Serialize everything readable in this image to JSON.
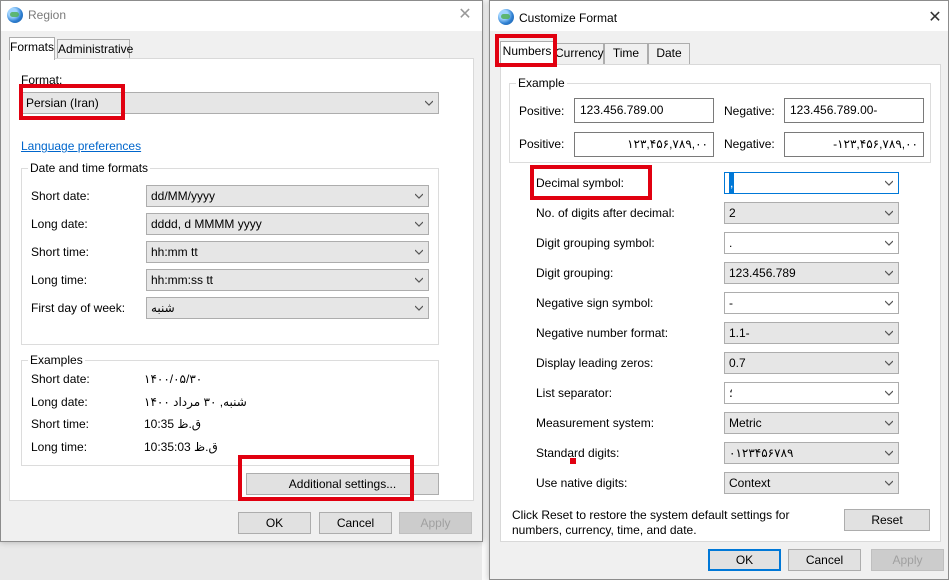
{
  "region": {
    "title": "Region",
    "tabs": [
      "Formats",
      "Administrative"
    ],
    "format_label": "Format:",
    "format_value": "Persian (Iran)",
    "language_link": "Language preferences",
    "datetime_group": "Date and time formats",
    "fields": [
      {
        "label": "Short date:",
        "value": "dd/MM/yyyy"
      },
      {
        "label": "Long date:",
        "value": "dddd, d MMMM yyyy"
      },
      {
        "label": "Short time:",
        "value": "hh:mm tt"
      },
      {
        "label": "Long time:",
        "value": "hh:mm:ss tt"
      },
      {
        "label": "First day of week:",
        "value": "شنبه"
      }
    ],
    "examples_group": "Examples",
    "examples": [
      {
        "label": "Short date:",
        "value": "۱۴۰۰/۰۵/۳۰"
      },
      {
        "label": "Long date:",
        "value": "شنبه, ۳۰ مرداد ۱۴۰۰"
      },
      {
        "label": "Short time:",
        "value": "10:35 ق.ظ"
      },
      {
        "label": "Long time:",
        "value": "10:35:03 ق.ظ"
      }
    ],
    "additional_button": "Additional settings...",
    "ok": "OK",
    "cancel": "Cancel",
    "apply": "Apply"
  },
  "customize": {
    "title": "Customize Format",
    "tabs": [
      "Numbers",
      "Currency",
      "Time",
      "Date"
    ],
    "example_group": "Example",
    "positive_label": "Positive:",
    "negative_label": "Negative:",
    "positive_1": "123.456.789.00",
    "negative_1": "123.456.789.00-",
    "positive_2": "۱۲۳,۴۵۶,۷۸۹,۰۰",
    "negative_2": "-۱۲۳,۴۵۶,۷۸۹,۰۰",
    "settings": [
      {
        "label": "Decimal symbol:",
        "value": ","
      },
      {
        "label": "No. of digits after decimal:",
        "value": "2"
      },
      {
        "label": "Digit grouping symbol:",
        "value": "."
      },
      {
        "label": "Digit grouping:",
        "value": "123.456.789"
      },
      {
        "label": "Negative sign symbol:",
        "value": "-"
      },
      {
        "label": "Negative number format:",
        "value": "1.1-"
      },
      {
        "label": "Display leading zeros:",
        "value": "0.7"
      },
      {
        "label": "List separator:",
        "value": "؛"
      },
      {
        "label": "Measurement system:",
        "value": "Metric"
      },
      {
        "label": "Standard digits:",
        "value": "۰۱۲۳۴۵۶۷۸۹"
      },
      {
        "label": "Use native digits:",
        "value": "Context"
      }
    ],
    "reset_text": "Click Reset to restore the system default settings for numbers, currency, time, and date.",
    "reset_button": "Reset",
    "ok": "OK",
    "cancel": "Cancel",
    "apply": "Apply"
  },
  "colors": {
    "highlight": "#e10010",
    "link": "#0066cc",
    "focus": "#0078d7"
  }
}
